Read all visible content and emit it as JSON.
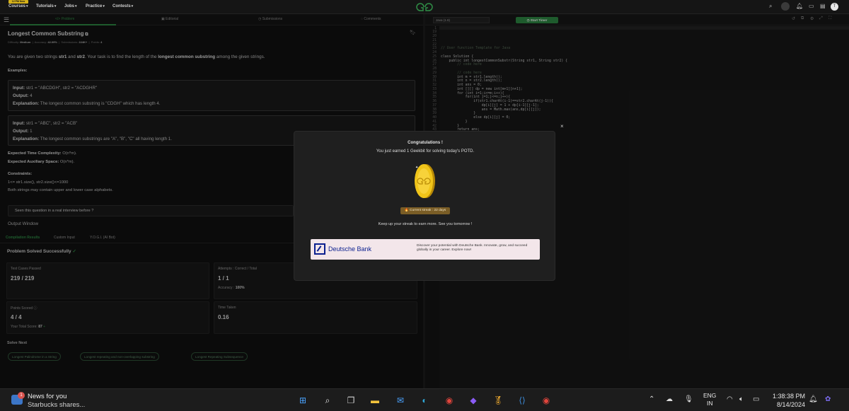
{
  "nav": {
    "badge": "12 PM Now",
    "items": [
      {
        "label": "Courses"
      },
      {
        "label": "Tutorials"
      },
      {
        "label": "Jobs"
      },
      {
        "label": "Practice"
      },
      {
        "label": "Contests"
      }
    ],
    "logo": "GfG",
    "avatar_letter": "T"
  },
  "left": {
    "tabs": [
      "Problem",
      "Editorial",
      "Submissions",
      "Comments"
    ],
    "title": "Longest Common Substring",
    "meta": {
      "difficulty_label": "Difficulty:",
      "difficulty": "Medium",
      "accuracy_label": "Accuracy:",
      "accuracy": "42.09%",
      "submissions_label": "Submissions:",
      "submissions": "224K+",
      "points_label": "Points:",
      "points": "4"
    },
    "desc_pre": "You are given two strings ",
    "desc_s1": "str1",
    "desc_and": " and ",
    "desc_s2": "str2",
    "desc_mid": ". Your task is to find the length of the ",
    "desc_bold": "longest common substring",
    "desc_post": " among the given strings.",
    "examples_label": "Examples:",
    "examples": [
      {
        "input_label": "Input:",
        "input": "str1 = \"ABCDGH\", str2 = \"ACDGHR\"",
        "output_label": "Output:",
        "output": "4",
        "expl_label": "Explanation:",
        "expl": "The longest common substring is \"CDGH\" which has length 4."
      },
      {
        "input_label": "Input:",
        "input": "str1 = \"ABC\", str2 = \"ACB\"",
        "output_label": "Output:",
        "output": "1",
        "expl_label": "Explanation:",
        "expl": "The longest common substrings are \"A\", \"B\", \"C\" all having length 1."
      }
    ],
    "time_label": "Expected Time Complexity:",
    "time": "O(n*m).",
    "space_label": "Expected Auxiliary Space:",
    "space": "O(n*m).",
    "constraints_label": "Constraints:",
    "constraint1": "1<= str1.size(), str2.size()<=1000",
    "constraint2": "Both strings may contain upper and lower case alphabets.",
    "seen": "Seen this question in a real interview before ?",
    "output_window": "Output Window",
    "out_tabs": [
      "Compilation Results",
      "Custom Input",
      "Y.O.G.I. (AI Bot)"
    ],
    "solved": "Problem Solved Successfully",
    "stats": {
      "tests_label": "Test Cases Passed",
      "tests": "219 / 219",
      "attempts_label": "Attempts : Correct / Total",
      "attempts": "1 / 1",
      "accuracy_label": "Accuracy :",
      "accuracy": "100%",
      "points_label": "Points Scored",
      "points": "4 / 4",
      "total_label": "Your Total Score:",
      "total": "87",
      "time_label": "Time Taken",
      "time": "0.16"
    },
    "solve_next": "Solve Next",
    "chips": [
      "Longest Palindrome in a String",
      "Longest repeating and non-overlapping substring",
      "Longest Repeating Subsequence"
    ]
  },
  "editor": {
    "language": "Java (1.8)",
    "start_timer": "Start Timer",
    "lines": [
      {
        "n": "1",
        "t": ""
      },
      {
        "n": "19",
        "t": ""
      },
      {
        "n": "20",
        "t": ""
      },
      {
        "n": "21",
        "t": ""
      },
      {
        "n": "22",
        "t": ""
      },
      {
        "n": "23",
        "t": "// User function Template for Java",
        "c": true
      },
      {
        "n": "24",
        "t": ""
      },
      {
        "n": "25",
        "t": "class Solution {"
      },
      {
        "n": "26",
        "t": "    public int longestCommonSubstr(String str1, String str2) {"
      },
      {
        "n": "27",
        "t": "        // code here",
        "c": true
      },
      {
        "n": "28",
        "t": ""
      },
      {
        "n": "29",
        "t": "        // code here",
        "c": true
      },
      {
        "n": "30",
        "t": "        int m = str1.length();"
      },
      {
        "n": "31",
        "t": "        int n = str2.length();"
      },
      {
        "n": "32",
        "t": "        int ans = 0;"
      },
      {
        "n": "33",
        "t": "        int [][] dp = new int[m+1][n+1];"
      },
      {
        "n": "34",
        "t": "        for (int i=1;i<=m;i++){"
      },
      {
        "n": "35",
        "t": "            for(int j=1;j<=n;j++){"
      },
      {
        "n": "36",
        "t": "                if(str1.charAt(i-1)==str2.charAt(j-1)){"
      },
      {
        "n": "37",
        "t": "                    dp[i][j] = 1 + dp[i-1][j-1];"
      },
      {
        "n": "38",
        "t": "                    ans = Math.max(ans,dp[i][j]);"
      },
      {
        "n": "39",
        "t": "                }"
      },
      {
        "n": "40",
        "t": "                else dp[i][j] = 0;"
      },
      {
        "n": "41",
        "t": "            }"
      },
      {
        "n": "42",
        "t": "        }"
      },
      {
        "n": "43",
        "t": "        return ans;"
      }
    ]
  },
  "modal": {
    "close": "×",
    "title": "Congratulations !",
    "earned": "You just earned 1 Geekbit for solving today's POTD.",
    "streak": "🔥 Current streak : 22 days",
    "keepup": "Keep up your streak to earn more. See you tomorrow !",
    "ad_brand": "Deutsche Bank",
    "ad_text": "Discover your potential with Deutsche Bank. Innovate, grow, and succeed globally in your career. Explore now!"
  },
  "taskbar": {
    "news_title": "News for you",
    "news_sub": "Starbucks shares...",
    "notif_count": "1",
    "lang1": "ENG",
    "lang2": "IN",
    "time": "1:38:38 PM",
    "date": "8/14/2024"
  }
}
